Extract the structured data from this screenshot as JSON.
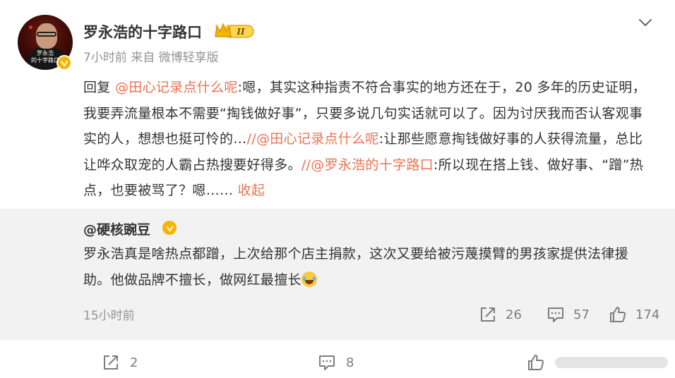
{
  "post": {
    "author": "罗永浩的十字路口",
    "level_badge": "II",
    "time": "7小时前",
    "source": "来自 微博轻享版",
    "avatar_caption_line1": "罗永浩",
    "avatar_caption_line2": "的十字路口",
    "text_parts": {
      "p1": "回复 ",
      "link1": "@田心记录点什么呢",
      "p2": ":嗯，其实这种指责不符合事实的地方还在于，20 多年的历史证明，我要弄流量根本不需要“掏钱做好事”，只要多说几句实话就可以了。因为讨厌我而否认客观事实的人，想想也挺可怜的…",
      "link2": "//@田心记录点什么呢",
      "p3": ":让那些愿意掏钱做好事的人获得流量，总比让哗众取宠的人霸占热搜要好得多。",
      "link3": "//@罗永浩的十字路口",
      "p4": ":所以现在搭上钱、做好事、“蹭”热点，也要被骂了？嗯……",
      "collapse": "收起"
    }
  },
  "quoted": {
    "author": "@硬核豌豆",
    "text": "罗永浩真是啥热点都蹭，上次给那个店主捐款，这次又要给被污蔑摸臂的男孩家提供法律援助。他做品牌不擅长，做网红最擅长",
    "time": "15小时前",
    "repost_count": "26",
    "comment_count": "57",
    "like_count": "174"
  },
  "actions": {
    "repost_count": "2",
    "comment_count": "8"
  },
  "colors": {
    "link": "#eb7350",
    "badge": "#f7b500",
    "quote_bg": "#f2f2f2"
  }
}
